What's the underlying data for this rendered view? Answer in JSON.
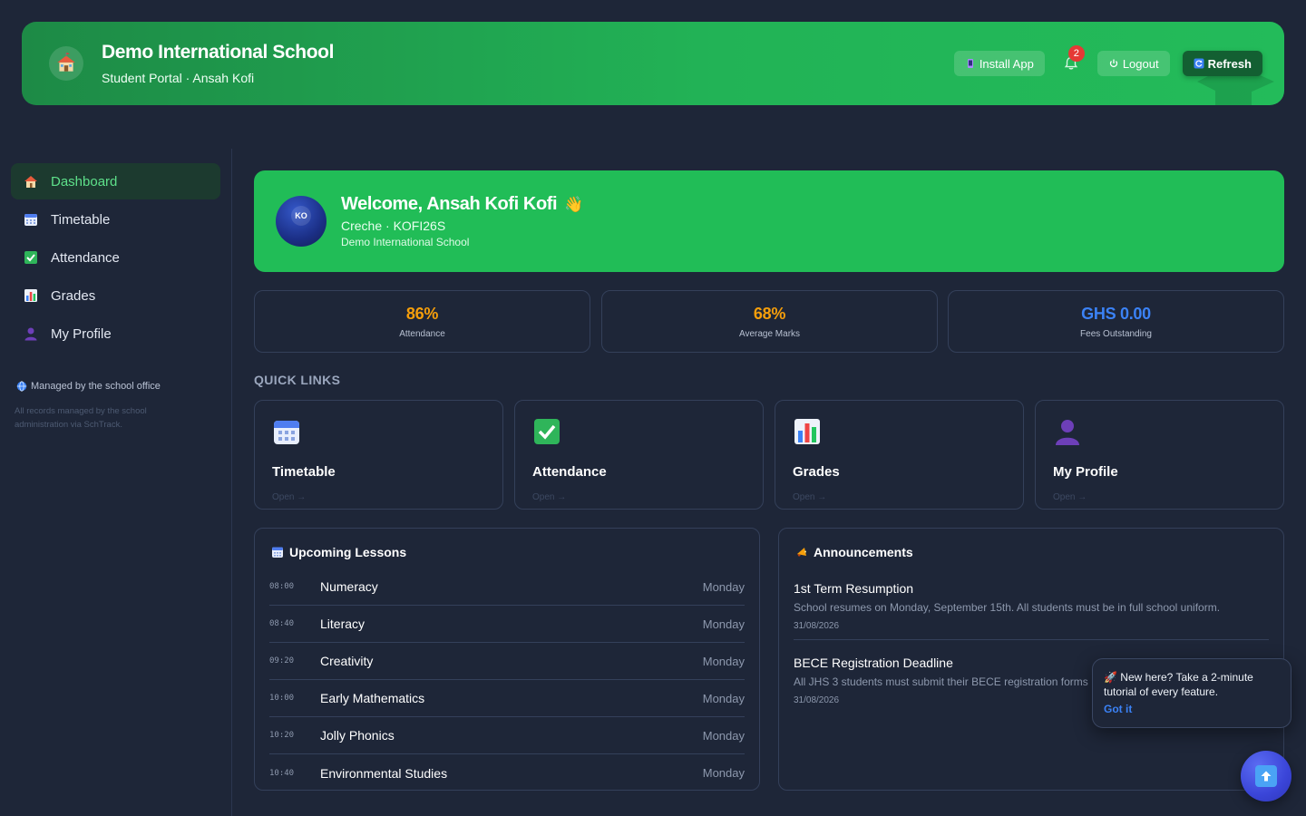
{
  "header": {
    "school_name": "Demo International School",
    "subtitle": "Student Portal · Ansah Kofi",
    "install_label": "Install App",
    "notification_count": "2",
    "logout_label": "Logout",
    "refresh_label": "Refresh",
    "logo_icon": "school-house-icon"
  },
  "sidebar": {
    "items": [
      {
        "label": "Dashboard",
        "icon": "house-icon",
        "active": true
      },
      {
        "label": "Timetable",
        "icon": "calendar-icon",
        "active": false
      },
      {
        "label": "Attendance",
        "icon": "checkbox-icon",
        "active": false
      },
      {
        "label": "Grades",
        "icon": "bar-chart-icon",
        "active": false
      },
      {
        "label": "My Profile",
        "icon": "user-icon",
        "active": false
      }
    ],
    "managed_label": "Managed by the school office",
    "managed_note": "All records managed by the school administration via SchTrack."
  },
  "welcome": {
    "initials": "KO",
    "title": "Welcome, Ansah Kofi Kofi",
    "wave": "👋",
    "class_info": "Creche · KOFI26S",
    "school": "Demo International School"
  },
  "stats": [
    {
      "value": "86%",
      "label": "Attendance",
      "color": "#f59e0b"
    },
    {
      "value": "68%",
      "label": "Average Marks",
      "color": "#f59e0b"
    },
    {
      "value": "GHS 0.00",
      "label": "Fees Outstanding",
      "color": "#3b82f6"
    }
  ],
  "quick_links": {
    "title": "QUICK LINKS",
    "items": [
      {
        "label": "Timetable",
        "open": "Open →",
        "icon": "calendar-icon"
      },
      {
        "label": "Attendance",
        "open": "Open →",
        "icon": "checkbox-icon"
      },
      {
        "label": "Grades",
        "open": "Open →",
        "icon": "bar-chart-icon"
      },
      {
        "label": "My Profile",
        "open": "Open →",
        "icon": "user-icon"
      }
    ]
  },
  "lessons": {
    "title": "Upcoming Lessons",
    "items": [
      {
        "time": "08:00",
        "subject": "Numeracy",
        "day": "Monday"
      },
      {
        "time": "08:40",
        "subject": "Literacy",
        "day": "Monday"
      },
      {
        "time": "09:20",
        "subject": "Creativity",
        "day": "Monday"
      },
      {
        "time": "10:00",
        "subject": "Early Mathematics",
        "day": "Monday"
      },
      {
        "time": "10:20",
        "subject": "Jolly Phonics",
        "day": "Monday"
      },
      {
        "time": "10:40",
        "subject": "Environmental Studies",
        "day": "Monday"
      }
    ]
  },
  "announcements": {
    "title": "Announcements",
    "items": [
      {
        "title": "1st Term Resumption",
        "body": "School resumes on Monday, September 15th. All students must be in full school uniform.",
        "date": "31/08/2026"
      },
      {
        "title": "BECE Registration Deadline",
        "body": "All JHS 3 students must submit their BECE registration forms",
        "date": "31/08/2026"
      }
    ]
  },
  "toast": {
    "icon": "rocket-icon",
    "text": "New here? Take a 2-minute tutorial of every feature.",
    "action": "Got it"
  },
  "colors": {
    "header_green": "#22b356",
    "welcome_green": "#21bd57",
    "active_nav": "#5ee08a",
    "accent_blue": "#3b82f6"
  }
}
